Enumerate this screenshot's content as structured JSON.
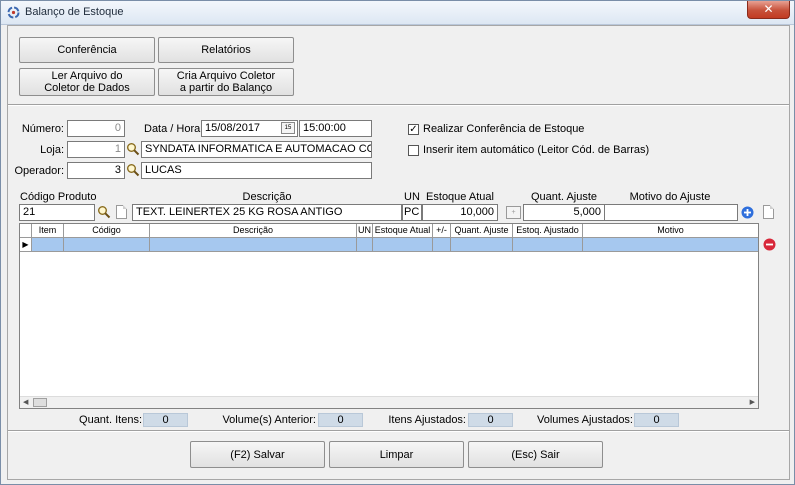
{
  "window": {
    "title": "Balanço de Estoque",
    "close_glyph": "✕"
  },
  "toolbar": {
    "conferencia": "Conferência",
    "relatorios": "Relatórios",
    "ler_arquivo": [
      "Ler Arquivo do",
      "Coletor de Dados"
    ],
    "cria_arquivo": [
      "Cria Arquivo Coletor",
      "a partir do Balanço"
    ]
  },
  "header": {
    "numero_label": "Número:",
    "numero_value": "0",
    "data_hora_label": "Data / Hora:",
    "date_value": "15/08/2017",
    "calendar_badge": "15",
    "time_value": "15:00:00",
    "loja_label": "Loja:",
    "loja_code": "1",
    "loja_name": "SYNDATA INFORMATICA E AUTOMACAO COME",
    "operador_label": "Operador:",
    "operador_code": "3",
    "operador_name": "LUCAS",
    "realizar_conferencia_label": "Realizar Conferência de Estoque",
    "realizar_conferencia_checked": true,
    "inserir_auto_label": "Inserir item automático (Leitor Cód. de Barras)",
    "inserir_auto_checked": false
  },
  "item_entry": {
    "codigo_label": "Código Produto",
    "codigo_value": "21",
    "descricao_label": "Descrição",
    "descricao_value": "TEXT. LEINERTEX 25 KG ROSA ANTIGO",
    "un_label": "UN",
    "un_value": "PC",
    "estoque_label": "Estoque Atual",
    "estoque_value": "10,000",
    "spin_glyph": "+",
    "ajuste_label": "Quant. Ajuste",
    "ajuste_value": "5,000",
    "motivo_label": "Motivo do Ajuste",
    "motivo_value": ""
  },
  "grid": {
    "columns": [
      "Item",
      "Código",
      "Descrição",
      "UN",
      "Estoque Atual",
      "+/-",
      "Quant. Ajuste",
      "Estoq. Ajustado",
      "Motivo"
    ],
    "row_indicator": "▶"
  },
  "status": {
    "quant_itens_label": "Quant. Itens:",
    "quant_itens_value": "0",
    "volume_anterior_label": "Volume(s) Anterior:",
    "volume_anterior_value": "0",
    "itens_ajustados_label": "Itens Ajustados:",
    "itens_ajustados_value": "0",
    "volumes_ajustados_label": "Volumes Ajustados:",
    "volumes_ajustados_value": "0"
  },
  "footer": {
    "salvar": "(F2) Salvar",
    "limpar": "Limpar",
    "sair": "(Esc) Sair"
  },
  "colors": {
    "selection": "#a6c8ef",
    "add_icon": "#2f6fdc",
    "remove_icon": "#d8283a",
    "stat_bg": "#cfdbe7"
  }
}
